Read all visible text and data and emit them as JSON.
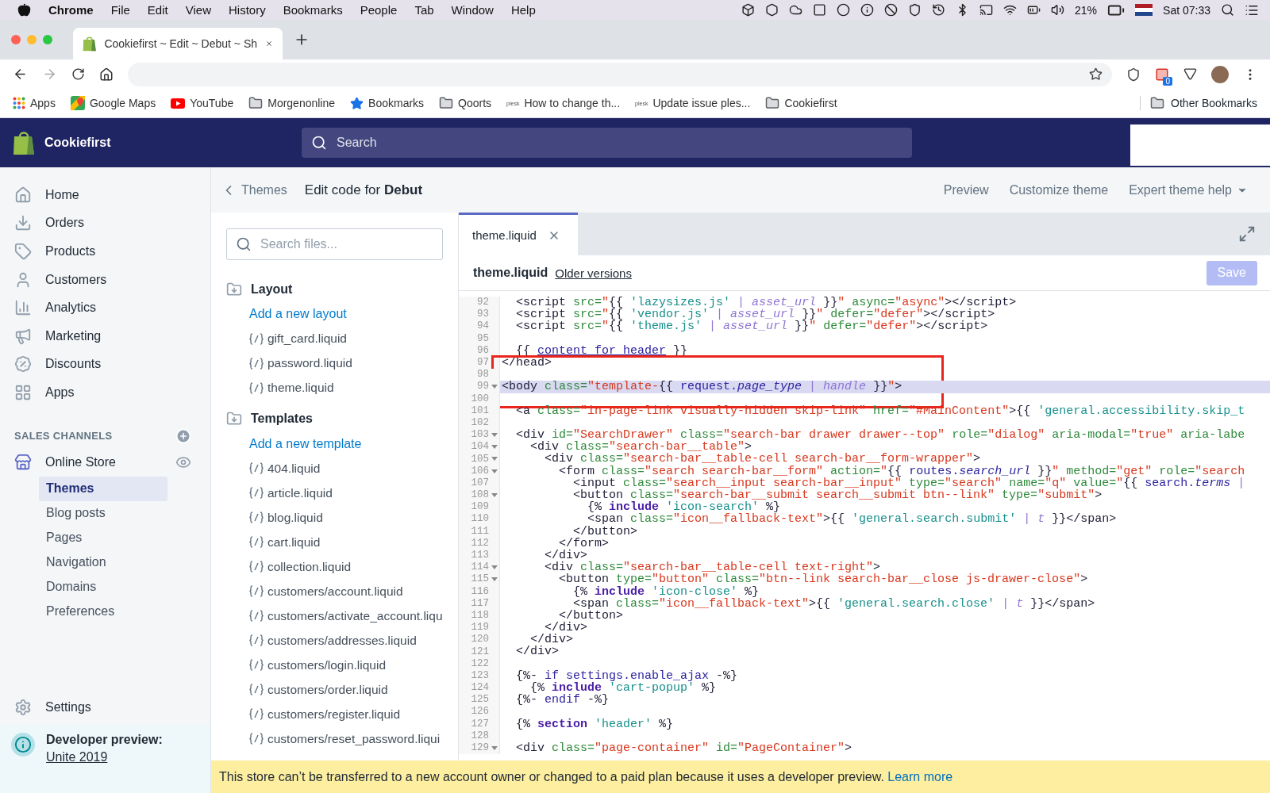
{
  "menu_bar": {
    "app": "Chrome",
    "items": [
      "File",
      "Edit",
      "View",
      "History",
      "Bookmarks",
      "People",
      "Tab",
      "Window",
      "Help"
    ],
    "battery": "21%",
    "clock": "Sat 07:33"
  },
  "browser": {
    "tab": {
      "title": "Cookiefirst ~ Edit ~ Debut ~ Sh"
    },
    "extension_badge": "0",
    "bookmarks": [
      {
        "label": "Apps",
        "kind": "apps"
      },
      {
        "label": "Google Maps",
        "kind": "maps"
      },
      {
        "label": "YouTube",
        "kind": "video"
      },
      {
        "label": "Morgenonline",
        "kind": "folder"
      },
      {
        "label": "Bookmarks",
        "kind": "star"
      },
      {
        "label": "Qoorts",
        "kind": "folder"
      },
      {
        "label": "How to change th...",
        "kind": "site",
        "badge": "plesk"
      },
      {
        "label": "Update issue ples...",
        "kind": "site",
        "badge": "plesk"
      },
      {
        "label": "Cookiefirst",
        "kind": "folder"
      }
    ],
    "other_bookmarks": "Other Bookmarks"
  },
  "admin": {
    "store": "Cookiefirst",
    "search": {
      "placeholder": "Search"
    }
  },
  "sidebar": {
    "nav": [
      {
        "label": "Home",
        "selected": false
      },
      {
        "label": "Orders",
        "selected": false
      },
      {
        "label": "Products",
        "selected": false
      },
      {
        "label": "Customers",
        "selected": false
      },
      {
        "label": "Analytics",
        "selected": false
      },
      {
        "label": "Marketing",
        "selected": false
      },
      {
        "label": "Discounts",
        "selected": false
      },
      {
        "label": "Apps",
        "selected": false
      }
    ],
    "sales_channels": "SALES CHANNELS",
    "channel": "Online Store",
    "subitems": [
      {
        "label": "Themes",
        "selected": true
      },
      {
        "label": "Blog posts",
        "selected": false
      },
      {
        "label": "Pages",
        "selected": false
      },
      {
        "label": "Navigation",
        "selected": false
      },
      {
        "label": "Domains",
        "selected": false
      },
      {
        "label": "Preferences",
        "selected": false
      }
    ],
    "settings": "Settings",
    "developer_preview": {
      "title": "Developer preview:",
      "link": "Unite 2019"
    }
  },
  "page_header": {
    "back": "Themes",
    "title": "Edit code for **Debut**",
    "actions": [
      "Preview",
      "Customize theme",
      "Expert theme help"
    ]
  },
  "files": {
    "search": {
      "placeholder": "Search files..."
    },
    "sections": [
      {
        "title": "Layout",
        "add": "Add a new layout",
        "files": [
          "gift_card.liquid",
          "password.liquid",
          "theme.liquid"
        ]
      },
      {
        "title": "Templates",
        "add": "Add a new template",
        "files": [
          "404.liquid",
          "article.liquid",
          "blog.liquid",
          "cart.liquid",
          "collection.liquid",
          "customers/account.liquid",
          "customers/activate_account.liqu",
          "customers/addresses.liquid",
          "customers/login.liquid",
          "customers/order.liquid",
          "customers/register.liquid",
          "customers/reset_password.liqui"
        ]
      }
    ]
  },
  "editor": {
    "tabs": [
      {
        "label": "theme.liquid",
        "selected": true
      }
    ],
    "file": "theme.liquid",
    "older_versions": "Older versions",
    "save": {
      "label": "Save",
      "disabled": true
    },
    "lines": [
      {
        "n": "92",
        "fold": false,
        "selected": false,
        "boxed": false,
        "tokens": [
          {
            "text": "  <script",
            "kind": "tag"
          },
          {
            "text": " src=",
            "kind": "attr"
          },
          {
            "text": "\"",
            "kind": "str"
          },
          {
            "text": "{{ ",
            "kind": "lq"
          },
          {
            "text": "'lazysizes.js'",
            "kind": "lstr"
          },
          {
            "text": " | ",
            "kind": "pipe"
          },
          {
            "text": "asset_url",
            "kind": "flt"
          },
          {
            "text": " }}",
            "kind": "lq"
          },
          {
            "text": "\"",
            "kind": "str"
          },
          {
            "text": " async=",
            "kind": "attr"
          },
          {
            "text": "\"async\"",
            "kind": "str"
          },
          {
            "text": "></script>",
            "kind": "tag"
          }
        ]
      },
      {
        "n": "93",
        "fold": false,
        "selected": false,
        "boxed": false,
        "tokens": [
          {
            "text": "  <script",
            "kind": "tag"
          },
          {
            "text": " src=",
            "kind": "attr"
          },
          {
            "text": "\"",
            "kind": "str"
          },
          {
            "text": "{{ ",
            "kind": "lq"
          },
          {
            "text": "'vendor.js'",
            "kind": "lstr"
          },
          {
            "text": " | ",
            "kind": "pipe"
          },
          {
            "text": "asset_url",
            "kind": "flt"
          },
          {
            "text": " }}",
            "kind": "lq"
          },
          {
            "text": "\"",
            "kind": "str"
          },
          {
            "text": " defer=",
            "kind": "attr"
          },
          {
            "text": "\"defer\"",
            "kind": "str"
          },
          {
            "text": "></script>",
            "kind": "tag"
          }
        ]
      },
      {
        "n": "94",
        "fold": false,
        "selected": false,
        "boxed": false,
        "tokens": [
          {
            "text": "  <script",
            "kind": "tag"
          },
          {
            "text": " src=",
            "kind": "attr"
          },
          {
            "text": "\"",
            "kind": "str"
          },
          {
            "text": "{{ ",
            "kind": "lq"
          },
          {
            "text": "'theme.js'",
            "kind": "lstr"
          },
          {
            "text": " | ",
            "kind": "pipe"
          },
          {
            "text": "asset_url",
            "kind": "flt"
          },
          {
            "text": " }}",
            "kind": "lq"
          },
          {
            "text": "\"",
            "kind": "str"
          },
          {
            "text": " defer=",
            "kind": "attr"
          },
          {
            "text": "\"defer\"",
            "kind": "str"
          },
          {
            "text": "></script>",
            "kind": "tag"
          }
        ]
      },
      {
        "n": "95",
        "fold": false,
        "selected": false,
        "boxed": false
      },
      {
        "n": "96",
        "fold": false,
        "selected": false,
        "boxed": false,
        "tokens": [
          {
            "text": "  {{ ",
            "kind": "lq"
          },
          {
            "text": "content_for_header",
            "kind": "varu"
          },
          {
            "text": " }}",
            "kind": "lq"
          }
        ]
      },
      {
        "n": "97",
        "fold": false,
        "selected": false,
        "boxed": true,
        "tokens": [
          {
            "text": "</head>",
            "kind": "tag"
          }
        ]
      },
      {
        "n": "98",
        "fold": false,
        "selected": false,
        "boxed": true
      },
      {
        "n": "99",
        "fold": true,
        "selected": true,
        "boxed": true,
        "tokens": [
          {
            "text": "<body",
            "kind": "tag"
          },
          {
            "text": " class=",
            "kind": "attr"
          },
          {
            "text": "\"template-",
            "kind": "str"
          },
          {
            "text": "{{ ",
            "kind": "lq"
          },
          {
            "text": "request.",
            "kind": "var"
          },
          {
            "text": "page_type",
            "kind": "vi"
          },
          {
            "text": " | ",
            "kind": "pipe"
          },
          {
            "text": "handle",
            "kind": "flt"
          },
          {
            "text": " }}",
            "kind": "lq"
          },
          {
            "text": "\"",
            "kind": "str"
          },
          {
            "text": ">",
            "kind": "tag"
          }
        ]
      },
      {
        "n": "100",
        "fold": false,
        "selected": false,
        "boxed": true
      },
      {
        "n": "101",
        "fold": false,
        "selected": false,
        "boxed": false,
        "tokens": [
          {
            "text": "  <a",
            "kind": "tag"
          },
          {
            "text": " class=",
            "kind": "attr"
          },
          {
            "text": "\"in-page-link visually-hidden skip-link\"",
            "kind": "str"
          },
          {
            "text": " href=",
            "kind": "attr"
          },
          {
            "text": "\"#MainContent\"",
            "kind": "str"
          },
          {
            "text": ">",
            "kind": "tag"
          },
          {
            "text": "{{ ",
            "kind": "lq"
          },
          {
            "text": "'general.accessibility.skip_t",
            "kind": "lstr"
          }
        ]
      },
      {
        "n": "102",
        "fold": false,
        "selected": false,
        "boxed": false
      },
      {
        "n": "103",
        "fold": true,
        "selected": false,
        "boxed": false,
        "tokens": [
          {
            "text": "  <div",
            "kind": "tag"
          },
          {
            "text": " id=",
            "kind": "attr"
          },
          {
            "text": "\"SearchDrawer\"",
            "kind": "str"
          },
          {
            "text": " class=",
            "kind": "attr"
          },
          {
            "text": "\"search-bar drawer drawer--top\"",
            "kind": "str"
          },
          {
            "text": " role=",
            "kind": "attr"
          },
          {
            "text": "\"dialog\"",
            "kind": "str"
          },
          {
            "text": " aria-modal=",
            "kind": "attr"
          },
          {
            "text": "\"true\"",
            "kind": "str"
          },
          {
            "text": " aria-labe",
            "kind": "attr"
          }
        ]
      },
      {
        "n": "104",
        "fold": true,
        "selected": false,
        "boxed": false,
        "tokens": [
          {
            "text": "    <div",
            "kind": "tag"
          },
          {
            "text": " class=",
            "kind": "attr"
          },
          {
            "text": "\"search-bar__table\"",
            "kind": "str"
          },
          {
            "text": ">",
            "kind": "tag"
          }
        ]
      },
      {
        "n": "105",
        "fold": true,
        "selected": false,
        "boxed": false,
        "tokens": [
          {
            "text": "      <div",
            "kind": "tag"
          },
          {
            "text": " class=",
            "kind": "attr"
          },
          {
            "text": "\"search-bar__table-cell search-bar__form-wrapper\"",
            "kind": "str"
          },
          {
            "text": ">",
            "kind": "tag"
          }
        ]
      },
      {
        "n": "106",
        "fold": true,
        "selected": false,
        "boxed": false,
        "tokens": [
          {
            "text": "        <form",
            "kind": "tag"
          },
          {
            "text": " class=",
            "kind": "attr"
          },
          {
            "text": "\"search search-bar__form\"",
            "kind": "str"
          },
          {
            "text": " action=",
            "kind": "attr"
          },
          {
            "text": "\"",
            "kind": "str"
          },
          {
            "text": "{{ ",
            "kind": "lq"
          },
          {
            "text": "routes.",
            "kind": "var"
          },
          {
            "text": "search_url",
            "kind": "vi"
          },
          {
            "text": " }}",
            "kind": "lq"
          },
          {
            "text": "\"",
            "kind": "str"
          },
          {
            "text": " method=",
            "kind": "attr"
          },
          {
            "text": "\"get\"",
            "kind": "str"
          },
          {
            "text": " role=",
            "kind": "attr"
          },
          {
            "text": "\"search",
            "kind": "str"
          }
        ]
      },
      {
        "n": "107",
        "fold": false,
        "selected": false,
        "boxed": false,
        "tokens": [
          {
            "text": "          <input",
            "kind": "tag"
          },
          {
            "text": " class=",
            "kind": "attr"
          },
          {
            "text": "\"search__input search-bar__input\"",
            "kind": "str"
          },
          {
            "text": " type=",
            "kind": "attr"
          },
          {
            "text": "\"search\"",
            "kind": "str"
          },
          {
            "text": " name=",
            "kind": "attr"
          },
          {
            "text": "\"q\"",
            "kind": "str"
          },
          {
            "text": " value=",
            "kind": "attr"
          },
          {
            "text": "\"",
            "kind": "str"
          },
          {
            "text": "{{ ",
            "kind": "lq"
          },
          {
            "text": "search.",
            "kind": "var"
          },
          {
            "text": "terms",
            "kind": "vi"
          },
          {
            "text": " |",
            "kind": "pipe"
          }
        ]
      },
      {
        "n": "108",
        "fold": true,
        "selected": false,
        "boxed": false,
        "tokens": [
          {
            "text": "          <button",
            "kind": "tag"
          },
          {
            "text": " class=",
            "kind": "attr"
          },
          {
            "text": "\"search-bar__submit search__submit btn--link\"",
            "kind": "str"
          },
          {
            "text": " type=",
            "kind": "attr"
          },
          {
            "text": "\"submit\"",
            "kind": "str"
          },
          {
            "text": ">",
            "kind": "tag"
          }
        ]
      },
      {
        "n": "109",
        "fold": false,
        "selected": false,
        "boxed": false,
        "tokens": [
          {
            "text": "            {% ",
            "kind": "lq"
          },
          {
            "text": "include",
            "kind": "kw"
          },
          {
            "text": " 'icon-search'",
            "kind": "lstr"
          },
          {
            "text": " %}",
            "kind": "lq"
          }
        ]
      },
      {
        "n": "110",
        "fold": false,
        "selected": false,
        "boxed": false,
        "tokens": [
          {
            "text": "            <span",
            "kind": "tag"
          },
          {
            "text": " class=",
            "kind": "attr"
          },
          {
            "text": "\"icon__fallback-text\"",
            "kind": "str"
          },
          {
            "text": ">",
            "kind": "tag"
          },
          {
            "text": "{{ ",
            "kind": "lq"
          },
          {
            "text": "'general.search.submit'",
            "kind": "lstr"
          },
          {
            "text": " | ",
            "kind": "pipe"
          },
          {
            "text": "t",
            "kind": "flt"
          },
          {
            "text": " }}",
            "kind": "lq"
          },
          {
            "text": "</span>",
            "kind": "tag"
          }
        ]
      },
      {
        "n": "111",
        "fold": false,
        "selected": false,
        "boxed": false,
        "tokens": [
          {
            "text": "          </button>",
            "kind": "tag"
          }
        ]
      },
      {
        "n": "112",
        "fold": false,
        "selected": false,
        "boxed": false,
        "tokens": [
          {
            "text": "        </form>",
            "kind": "tag"
          }
        ]
      },
      {
        "n": "113",
        "fold": false,
        "selected": false,
        "boxed": false,
        "tokens": [
          {
            "text": "      </div>",
            "kind": "tag"
          }
        ]
      },
      {
        "n": "114",
        "fold": true,
        "selected": false,
        "boxed": false,
        "tokens": [
          {
            "text": "      <div",
            "kind": "tag"
          },
          {
            "text": " class=",
            "kind": "attr"
          },
          {
            "text": "\"search-bar__table-cell text-right\"",
            "kind": "str"
          },
          {
            "text": ">",
            "kind": "tag"
          }
        ]
      },
      {
        "n": "115",
        "fold": true,
        "selected": false,
        "boxed": false,
        "tokens": [
          {
            "text": "        <button",
            "kind": "tag"
          },
          {
            "text": " type=",
            "kind": "attr"
          },
          {
            "text": "\"button\"",
            "kind": "str"
          },
          {
            "text": " class=",
            "kind": "attr"
          },
          {
            "text": "\"btn--link search-bar__close js-drawer-close\"",
            "kind": "str"
          },
          {
            "text": ">",
            "kind": "tag"
          }
        ]
      },
      {
        "n": "116",
        "fold": false,
        "selected": false,
        "boxed": false,
        "tokens": [
          {
            "text": "          {% ",
            "kind": "lq"
          },
          {
            "text": "include",
            "kind": "kw"
          },
          {
            "text": " 'icon-close'",
            "kind": "lstr"
          },
          {
            "text": " %}",
            "kind": "lq"
          }
        ]
      },
      {
        "n": "117",
        "fold": false,
        "selected": false,
        "boxed": false,
        "tokens": [
          {
            "text": "          <span",
            "kind": "tag"
          },
          {
            "text": " class=",
            "kind": "attr"
          },
          {
            "text": "\"icon__fallback-text\"",
            "kind": "str"
          },
          {
            "text": ">",
            "kind": "tag"
          },
          {
            "text": "{{ ",
            "kind": "lq"
          },
          {
            "text": "'general.search.close'",
            "kind": "lstr"
          },
          {
            "text": " | ",
            "kind": "pipe"
          },
          {
            "text": "t",
            "kind": "flt"
          },
          {
            "text": " }}",
            "kind": "lq"
          },
          {
            "text": "</span>",
            "kind": "tag"
          }
        ]
      },
      {
        "n": "118",
        "fold": false,
        "selected": false,
        "boxed": false,
        "tokens": [
          {
            "text": "        </button>",
            "kind": "tag"
          }
        ]
      },
      {
        "n": "119",
        "fold": false,
        "selected": false,
        "boxed": false,
        "tokens": [
          {
            "text": "      </div>",
            "kind": "tag"
          }
        ]
      },
      {
        "n": "120",
        "fold": false,
        "selected": false,
        "boxed": false,
        "tokens": [
          {
            "text": "    </div>",
            "kind": "tag"
          }
        ]
      },
      {
        "n": "121",
        "fold": false,
        "selected": false,
        "boxed": false,
        "tokens": [
          {
            "text": "  </div>",
            "kind": "tag"
          }
        ]
      },
      {
        "n": "122",
        "fold": false,
        "selected": false,
        "boxed": false
      },
      {
        "n": "123",
        "fold": false,
        "selected": false,
        "boxed": false,
        "tokens": [
          {
            "text": "  {%- ",
            "kind": "lq"
          },
          {
            "text": "if settings.enable_ajax",
            "kind": "var"
          },
          {
            "text": " -%}",
            "kind": "lq"
          }
        ]
      },
      {
        "n": "124",
        "fold": false,
        "selected": false,
        "boxed": false,
        "tokens": [
          {
            "text": "    {% ",
            "kind": "lq"
          },
          {
            "text": "include",
            "kind": "kw"
          },
          {
            "text": " 'cart-popup'",
            "kind": "lstr"
          },
          {
            "text": " %}",
            "kind": "lq"
          }
        ]
      },
      {
        "n": "125",
        "fold": false,
        "selected": false,
        "boxed": false,
        "tokens": [
          {
            "text": "  {%- ",
            "kind": "lq"
          },
          {
            "text": "endif",
            "kind": "var"
          },
          {
            "text": " -%}",
            "kind": "lq"
          }
        ]
      },
      {
        "n": "126",
        "fold": false,
        "selected": false,
        "boxed": false
      },
      {
        "n": "127",
        "fold": false,
        "selected": false,
        "boxed": false,
        "tokens": [
          {
            "text": "  {% ",
            "kind": "lq"
          },
          {
            "text": "section",
            "kind": "kw"
          },
          {
            "text": " 'header'",
            "kind": "lstr"
          },
          {
            "text": " %}",
            "kind": "lq"
          }
        ]
      },
      {
        "n": "128",
        "fold": false,
        "selected": false,
        "boxed": false
      },
      {
        "n": "129",
        "fold": true,
        "selected": false,
        "boxed": false,
        "tokens": [
          {
            "text": "  <div",
            "kind": "tag"
          },
          {
            "text": " class=",
            "kind": "attr"
          },
          {
            "text": "\"page-container\"",
            "kind": "str"
          },
          {
            "text": " id=",
            "kind": "attr"
          },
          {
            "text": "\"PageContainer\"",
            "kind": "str"
          },
          {
            "text": ">",
            "kind": "tag"
          }
        ]
      }
    ]
  },
  "banner": {
    "text": "This store can’t be transferred to a new account owner or changed to a paid plan because it uses a developer preview.",
    "link": "Learn more"
  }
}
